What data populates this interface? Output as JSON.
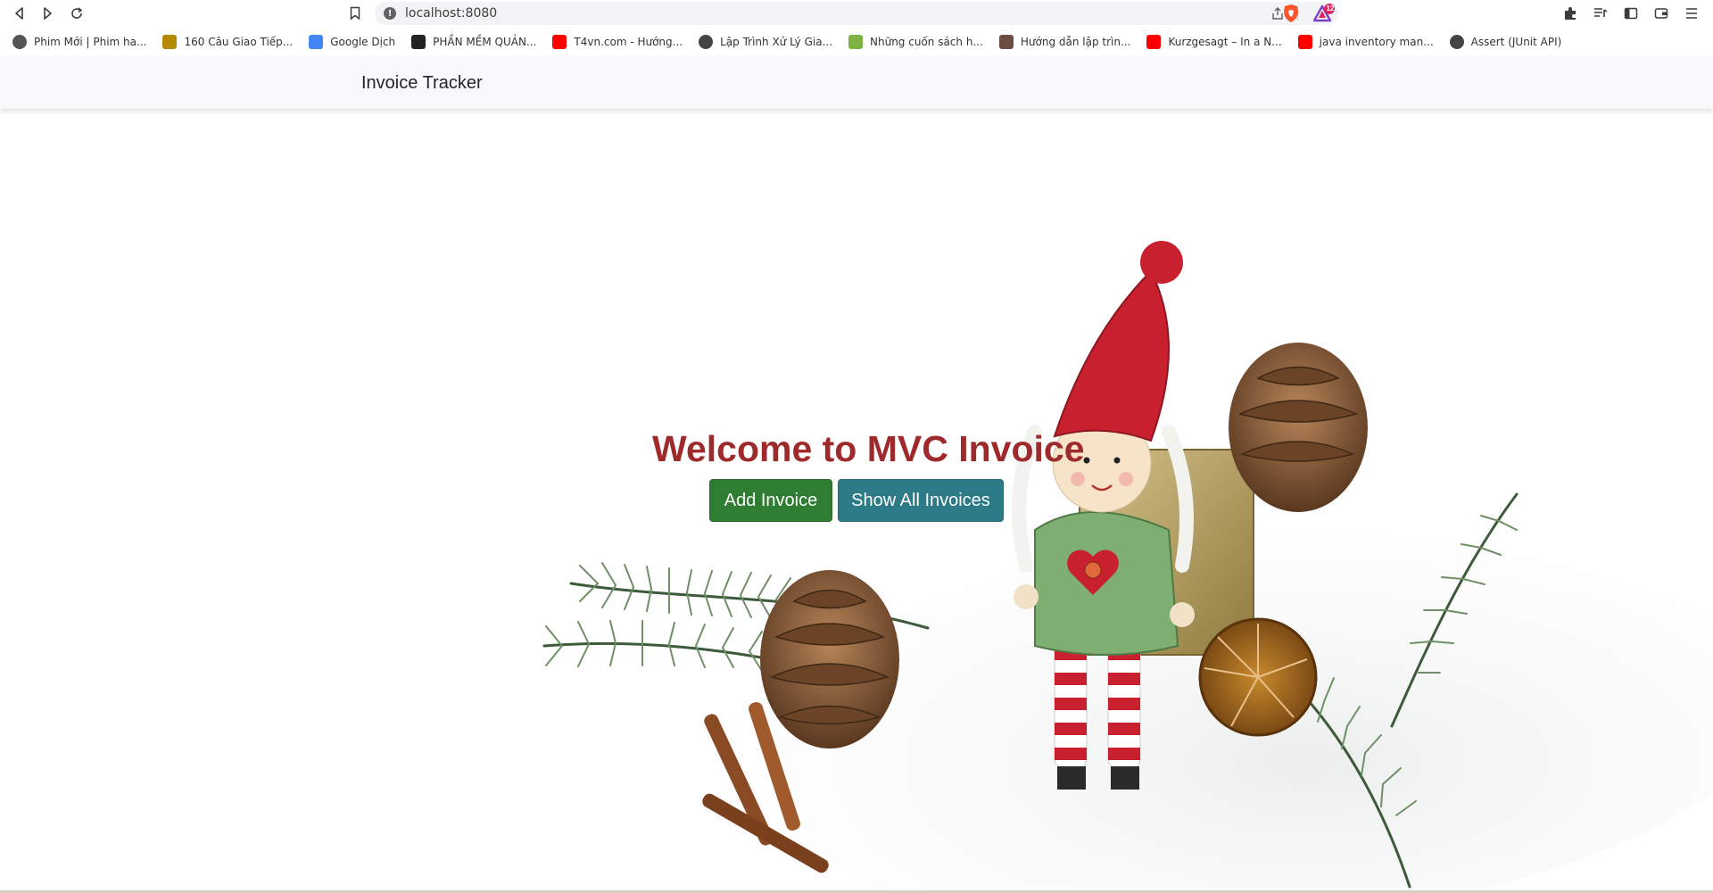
{
  "browser": {
    "url": "localhost:8080",
    "bookmarks": [
      {
        "label": "Phim Mới | Phim ha...",
        "color": "#555555",
        "icon": "globe-icon"
      },
      {
        "label": "160 Câu Giao Tiếp...",
        "color": "#b58a00",
        "icon": "badge-icon"
      },
      {
        "label": "Google Dịch",
        "color": "#4285f4",
        "icon": "translate-icon"
      },
      {
        "label": "PHẦN MỀM QUẢN...",
        "color": "#222222",
        "icon": "m-logo-icon"
      },
      {
        "label": "T4vn.com - Hướng...",
        "color": "#ff0000",
        "icon": "youtube-icon"
      },
      {
        "label": "Lập Trình Xử Lý Gia...",
        "color": "#444444",
        "icon": "globe-icon"
      },
      {
        "label": "Những cuốn sách h...",
        "color": "#7cb342",
        "icon": "book-icon"
      },
      {
        "label": "Hướng dẫn lập trìn...",
        "color": "#6d4c41",
        "icon": "avatar-icon"
      },
      {
        "label": "Kurzgesagt – In a N...",
        "color": "#ff0000",
        "icon": "youtube-icon"
      },
      {
        "label": "java inventory man...",
        "color": "#ff0000",
        "icon": "youtube-icon"
      },
      {
        "label": "Assert (JUnit API)",
        "color": "#444444",
        "icon": "globe-icon"
      }
    ],
    "rewards_badge": "12"
  },
  "app": {
    "brand": "Invoice Tracker",
    "title": "Welcome to MVC Invoice",
    "add_button": "Add Invoice",
    "show_button": "Show All Invoices",
    "colors": {
      "title": "#9e2a2b",
      "add_button": "#2e7d32",
      "show_button": "#2b7a85",
      "navbar": "#f8f9fa"
    }
  }
}
